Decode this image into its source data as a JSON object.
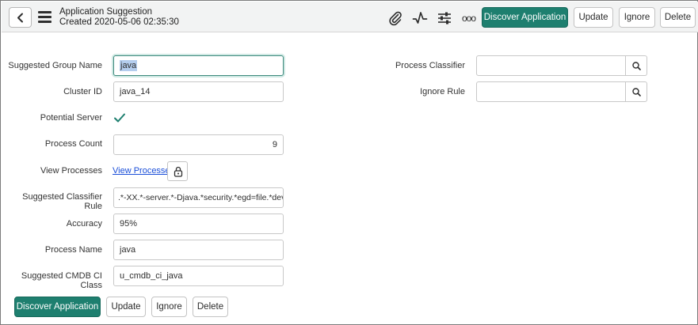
{
  "header": {
    "title": "Application Suggestion",
    "subtitle": "Created 2020-05-06 02:35:30",
    "icons": [
      "chevron-left-icon",
      "hamburger-menu-icon",
      "paperclip-icon",
      "activity-icon",
      "sliders-icon",
      "more-options-icon"
    ],
    "more_label": "ooo",
    "buttons": {
      "discover": "Discover Application",
      "update": "Update",
      "ignore": "Ignore",
      "delete": "Delete"
    }
  },
  "form": {
    "suggested_group_name": {
      "label": "Suggested Group Name",
      "value": "java"
    },
    "cluster_id": {
      "label": "Cluster ID",
      "value": "java_14"
    },
    "potential_server": {
      "label": "Potential Server",
      "checked": true
    },
    "process_count": {
      "label": "Process Count",
      "value": "9"
    },
    "view_processes": {
      "label": "View Processes",
      "link": "View Processes"
    },
    "suggested_classifier_rule": {
      "label": "Suggested Classifier Rule",
      "value": ".*-XX.*-server.*-Djava.*security.*egd=file.*dev.*"
    },
    "accuracy": {
      "label": "Accuracy",
      "value": "95%"
    },
    "process_name": {
      "label": "Process Name",
      "value": "java"
    },
    "suggested_cmdb_ci_class": {
      "label": "Suggested CMDB CI Class",
      "value": "u_cmdb_ci_java"
    },
    "process_classifier": {
      "label": "Process Classifier",
      "value": ""
    },
    "ignore_rule": {
      "label": "Ignore Rule",
      "value": ""
    }
  },
  "footer": {
    "buttons": {
      "discover": "Discover Application",
      "update": "Update",
      "ignore": "Ignore",
      "delete": "Delete"
    }
  },
  "colors": {
    "primary": "#1e7f6f",
    "header_bg": "#f2f3f3",
    "link": "#1a4ed8",
    "check": "#1e7f6f",
    "selection": "#b4cdee"
  }
}
